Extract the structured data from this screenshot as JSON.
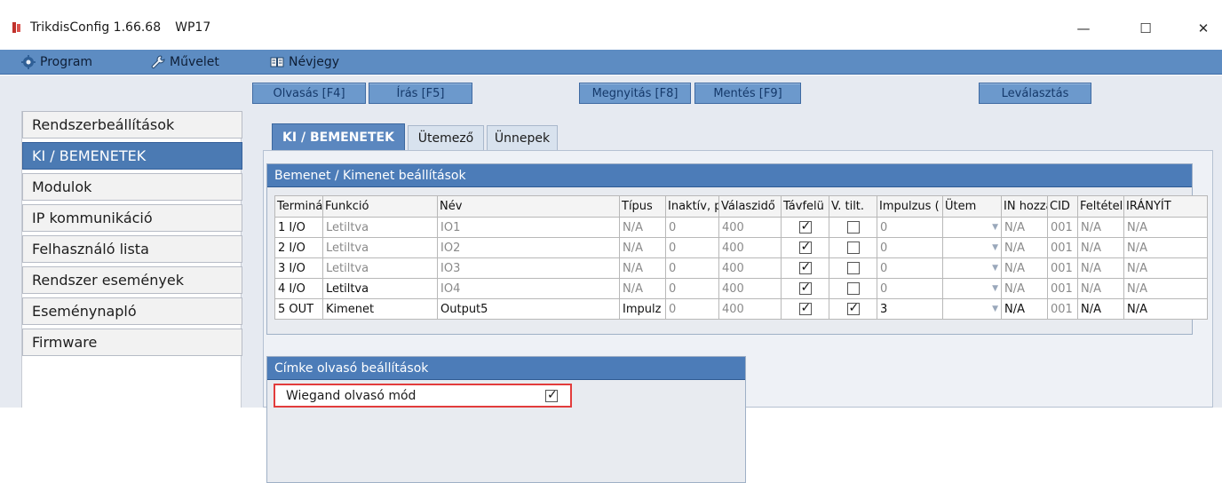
{
  "window": {
    "app_name": "TrikdisConfig 1.66.68",
    "device": "WP17",
    "minimize": "—",
    "maximize": "☐",
    "close": "✕"
  },
  "menu": {
    "program": "Program",
    "muvelet": "Művelet",
    "nevjegy": "Névjegy"
  },
  "toolbar": {
    "olvasas": "Olvasás [F4]",
    "iras": "Írás [F5]",
    "megnyitas": "Megnyitás [F8]",
    "mentes": "Mentés [F9]",
    "levalasztas": "Leválasztás"
  },
  "sidebar": {
    "items": [
      {
        "label": "Rendszerbeállítások"
      },
      {
        "label": "KI / BEMENETEK"
      },
      {
        "label": "Modulok"
      },
      {
        "label": "IP kommunikáció"
      },
      {
        "label": "Felhasználó lista"
      },
      {
        "label": "Rendszer események"
      },
      {
        "label": "Eseménynapló"
      },
      {
        "label": "Firmware"
      }
    ],
    "active_index": 1
  },
  "tabs": {
    "ki_bemenetek": "KI / BEMENETEK",
    "utemezo": "Ütemező",
    "unnepek": "Ünnepek"
  },
  "io_group": {
    "title": "Bemenet / Kimenet beállítások",
    "headers": [
      "Terminál",
      "Funkció",
      "Név",
      "Típus",
      "Inaktív, p",
      "Válaszidő",
      "Távfelü",
      "V. tilt.",
      "Impulzus (",
      "Ütem",
      "IN hozzá",
      "CID",
      "Feltétel",
      "IRÁNYÍT"
    ],
    "rows": [
      {
        "terminal": "1 I/O",
        "funkcio": "Letiltva",
        "nev": "IO1",
        "tipus": "N/A",
        "inaktiv": "0",
        "valaszido": "400",
        "tavfelugyelet": true,
        "vtilt": false,
        "impulzus": "0",
        "utem": "",
        "in": "N/A",
        "cid": "001",
        "feltetel": "N/A",
        "iranyit": "N/A"
      },
      {
        "terminal": "2 I/O",
        "funkcio": "Letiltva",
        "nev": "IO2",
        "tipus": "N/A",
        "inaktiv": "0",
        "valaszido": "400",
        "tavfelugyelet": true,
        "vtilt": false,
        "impulzus": "0",
        "utem": "",
        "in": "N/A",
        "cid": "001",
        "feltetel": "N/A",
        "iranyit": "N/A"
      },
      {
        "terminal": "3 I/O",
        "funkcio": "Letiltva",
        "nev": "IO3",
        "tipus": "N/A",
        "inaktiv": "0",
        "valaszido": "400",
        "tavfelugyelet": true,
        "vtilt": false,
        "impulzus": "0",
        "utem": "",
        "in": "N/A",
        "cid": "001",
        "feltetel": "N/A",
        "iranyit": "N/A"
      },
      {
        "terminal": "4 I/O",
        "funkcio": "Letiltva",
        "nev": "IO4",
        "tipus": "N/A",
        "inaktiv": "0",
        "valaszido": "400",
        "tavfelugyelet": true,
        "vtilt": false,
        "impulzus": "0",
        "utem": "",
        "in": "N/A",
        "cid": "001",
        "feltetel": "N/A",
        "iranyit": "N/A"
      },
      {
        "terminal": "5 OUT",
        "funkcio": "Kimenet",
        "nev": "Output5",
        "tipus": "Impulz",
        "inaktiv": "0",
        "valaszido": "400",
        "tavfelugyelet": true,
        "vtilt": true,
        "impulzus": "3",
        "utem": "",
        "in": "N/A",
        "cid": "001",
        "feltetel": "N/A",
        "iranyit": "N/A"
      }
    ]
  },
  "tag_group": {
    "title": "Címke olvasó beállítások",
    "wiegand_label": "Wiegand olvasó mód",
    "wiegand_checked": true
  },
  "colors": {
    "accent": "#4c7cb8",
    "menubar": "#5d8cc2",
    "highlight_border": "#e23c3c"
  }
}
